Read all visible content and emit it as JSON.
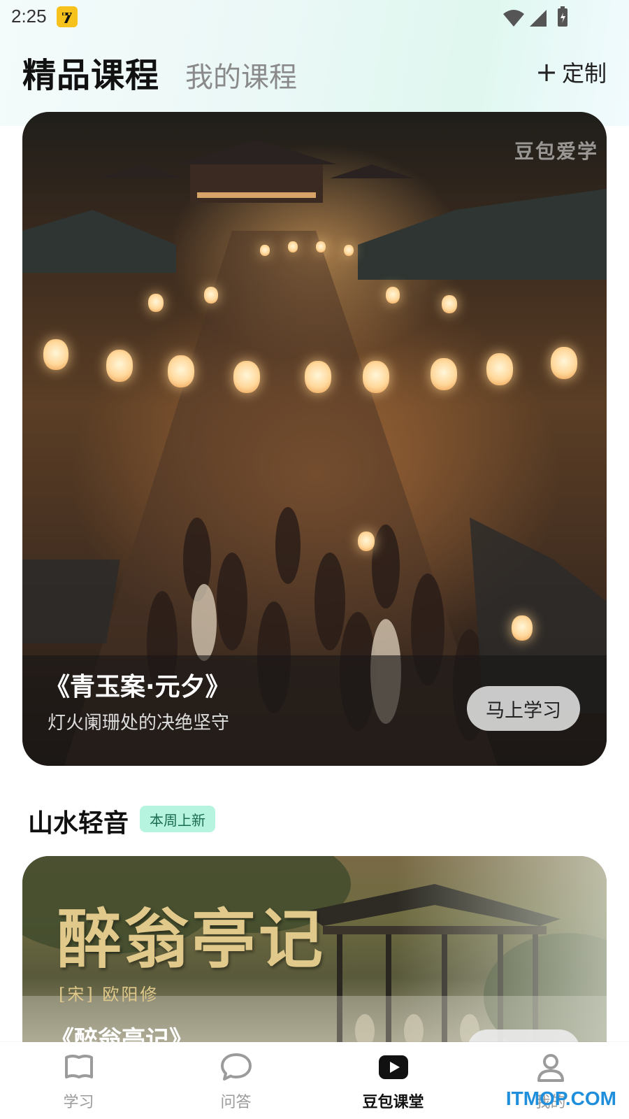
{
  "status_bar": {
    "time": "2:25"
  },
  "header": {
    "tab_active": "精品课程",
    "tab_inactive": "我的课程",
    "customize_label": "定制"
  },
  "hero": {
    "watermark": "豆包爱学",
    "title": "《青玉案·元夕》",
    "subtitle": "灯火阑珊处的决绝坚守",
    "button": "马上学习"
  },
  "section": {
    "title": "山水轻音",
    "badge": "本周上新"
  },
  "card2": {
    "calligraphy": "醉翁亭记",
    "author": "[宋] 欧阳修",
    "title": "《醉翁亭记》"
  },
  "bottom_nav": {
    "items": [
      {
        "label": "学习",
        "icon": "book-icon",
        "active": false
      },
      {
        "label": "问答",
        "icon": "chat-bubble-icon",
        "active": false
      },
      {
        "label": "豆包课堂",
        "icon": "play-icon",
        "active": true
      },
      {
        "label": "我的",
        "icon": "user-icon",
        "active": false
      }
    ]
  },
  "site_watermark": "ITMOP.COM",
  "colors": {
    "accent_badge_bg": "#b7f4df",
    "active_text": "#111111",
    "inactive_text": "#9b9b9b"
  }
}
